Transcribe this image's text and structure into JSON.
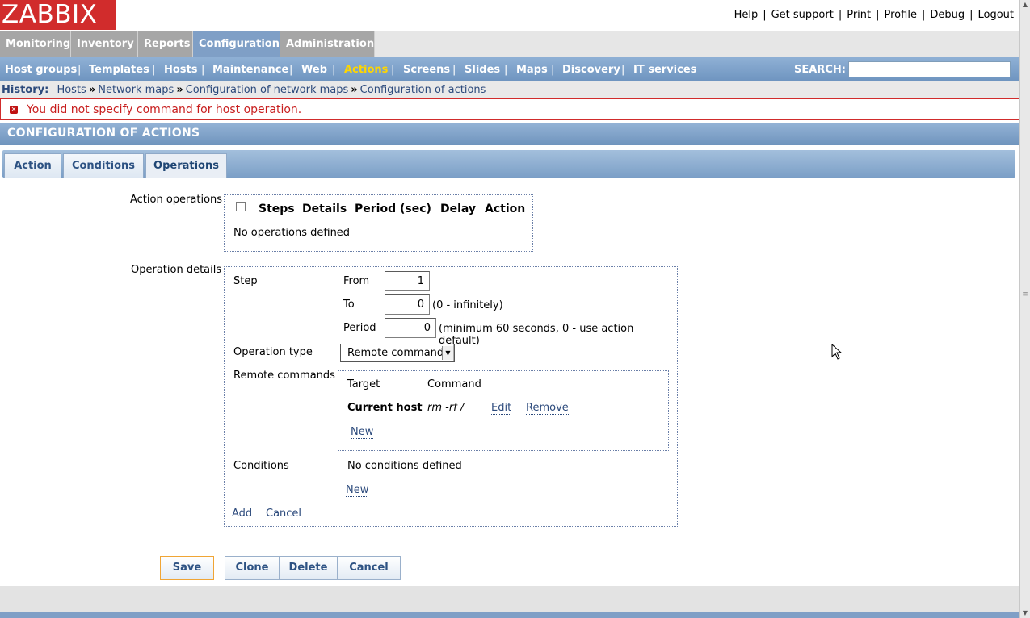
{
  "logo": "ZABBIX",
  "top_links": [
    "Help",
    "Get support",
    "Print",
    "Profile",
    "Debug",
    "Logout"
  ],
  "main_menu": [
    "Monitoring",
    "Inventory",
    "Reports",
    "Configuration",
    "Administration"
  ],
  "main_menu_selected": "Configuration",
  "sub_menu": [
    "Host groups",
    "Templates",
    "Hosts",
    "Maintenance",
    "Web",
    "Actions",
    "Screens",
    "Slides",
    "Maps",
    "Discovery",
    "IT services"
  ],
  "sub_menu_selected": "Actions",
  "search": {
    "label": "SEARCH:",
    "value": ""
  },
  "history": {
    "label": "History:",
    "items": [
      "Hosts",
      "Network maps",
      "Configuration of network maps",
      "Configuration of actions"
    ],
    "separator": "»"
  },
  "error": {
    "message": "You did not specify command for host operation."
  },
  "page_title": "CONFIGURATION OF ACTIONS",
  "tabs": [
    "Action",
    "Conditions",
    "Operations"
  ],
  "active_tab": "Operations",
  "action_operations": {
    "label": "Action operations",
    "columns": [
      "Steps",
      "Details",
      "Period (sec)",
      "Delay",
      "Action"
    ],
    "empty_text": "No operations defined"
  },
  "operation_details": {
    "label": "Operation details",
    "step": {
      "label": "Step",
      "from_label": "From",
      "from_value": "1",
      "to_label": "To",
      "to_value": "0",
      "to_hint": "(0 - infinitely)",
      "period_label": "Period",
      "period_value": "0",
      "period_hint": "(minimum 60 seconds, 0 - use action default)"
    },
    "operation_type": {
      "label": "Operation type",
      "value": "Remote command"
    },
    "remote_commands": {
      "label": "Remote commands",
      "columns": [
        "Target",
        "Command"
      ],
      "rows": [
        {
          "target": "Current host",
          "command": "rm -rf /",
          "edit": "Edit",
          "remove": "Remove"
        }
      ],
      "new_link": "New"
    },
    "conditions": {
      "label": "Conditions",
      "empty_text": "No conditions defined",
      "new_link": "New"
    },
    "add_link": "Add",
    "cancel_link": "Cancel"
  },
  "footer_buttons": {
    "save": "Save",
    "clone": "Clone",
    "delete": "Delete",
    "cancel": "Cancel"
  },
  "colors": {
    "brand_red": "#d12c2c",
    "menu_blue": "#7f9fc6",
    "selected_yellow": "#ffd600",
    "error_red": "#c81e1e"
  }
}
